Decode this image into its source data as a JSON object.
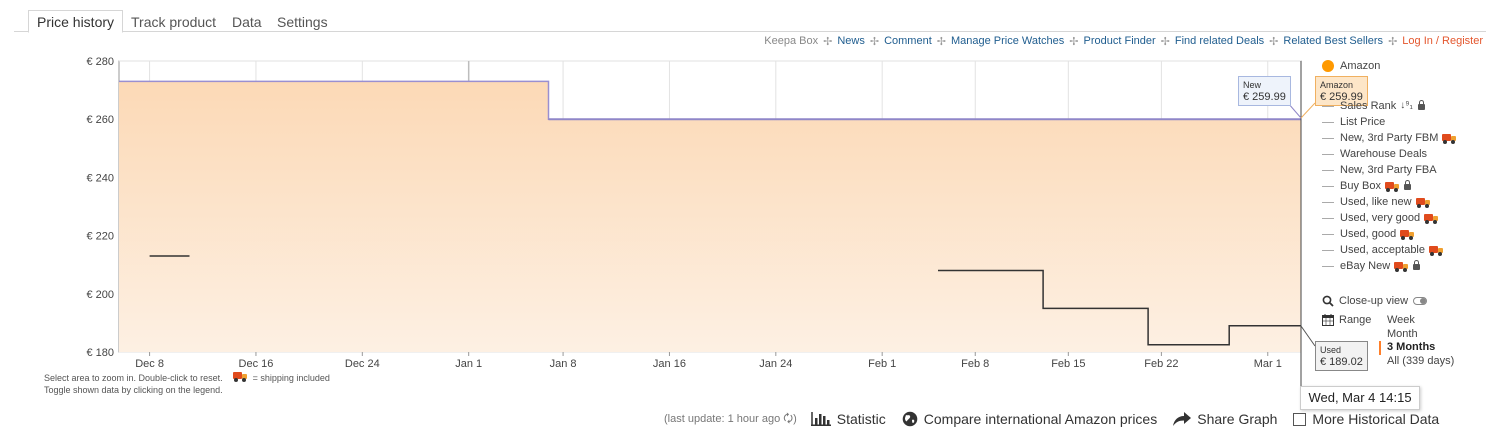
{
  "tabs": [
    {
      "label": "Price history"
    },
    {
      "label": "Track product"
    },
    {
      "label": "Data"
    },
    {
      "label": "Settings"
    }
  ],
  "links": [
    "Keepa Box",
    "News",
    "Comment",
    "Manage Price Watches",
    "Product Finder",
    "Find related Deals",
    "Related Best Sellers",
    "Log In / Register"
  ],
  "legend": {
    "amazon": "Amazon",
    "sales_rank": "Sales Rank",
    "list_price": "List Price",
    "new_fbm": "New, 3rd Party FBM",
    "warehouse": "Warehouse Deals",
    "new_fba": "New, 3rd Party FBA",
    "buy_box": "Buy Box",
    "used_like_new": "Used, like new",
    "used_very_good": "Used, very good",
    "used_good": "Used, good",
    "used_acceptable": "Used, acceptable",
    "ebay_new": "eBay New"
  },
  "controls": {
    "closeup": "Close-up view",
    "range": "Range",
    "range_options": [
      "Week",
      "Month",
      "3 Months",
      "All (339 days)"
    ],
    "range_selected": "3 Months"
  },
  "notes": {
    "line1": "Select area to zoom in. Double-click to reset.",
    "shipping": "= shipping included",
    "line2": "Toggle shown data by clicking on the legend."
  },
  "tooltip_date": "Wed, Mar 4 14:15",
  "bottom": {
    "last_update": "(last update: 1 hour ago",
    "statistic": "Statistic",
    "compare": "Compare international Amazon prices",
    "share": "Share Graph",
    "more": "More Historical Data"
  },
  "colors": {
    "amazon": "#ff9900",
    "amazon_fill": "#fde0c4",
    "new": "#8888cc",
    "used": "#333333",
    "accent": "#ff7f2a"
  },
  "chart_data": {
    "type": "area",
    "currency": "€",
    "ylim": [
      180,
      280
    ],
    "y_ticks": [
      280,
      260,
      240,
      220,
      200,
      180
    ],
    "y_tick_labels": [
      "€ 280",
      "€ 260",
      "€ 240",
      "€ 220",
      "€ 200",
      "€ 180"
    ],
    "x_ticks": [
      "Dec 8",
      "Dec 16",
      "Dec 24",
      "Jan 1",
      "Jan 8",
      "Jan 16",
      "Jan 24",
      "Feb 1",
      "Feb 8",
      "Feb 15",
      "Feb 22",
      "Mar 1"
    ],
    "xlim_days": [
      -2.3,
      86.6
    ],
    "x_tick_days": [
      0,
      8,
      16,
      24,
      31.1,
      39.1,
      47.1,
      55.1,
      62.1,
      69.1,
      76.1,
      84.1
    ],
    "series": [
      {
        "name": "Amazon",
        "kind": "step-area",
        "points": [
          [
            -2.3,
            273
          ],
          [
            30.0,
            273
          ],
          [
            30.0,
            260
          ],
          [
            86.6,
            259.99
          ]
        ]
      },
      {
        "name": "New",
        "kind": "step",
        "points": [
          [
            30.0,
            260
          ],
          [
            86.6,
            259.99
          ]
        ]
      },
      {
        "name": "Used",
        "kind": "step",
        "segments": [
          [
            [
              0,
              213
            ],
            [
              3,
              213
            ]
          ],
          [
            [
              59.3,
              208
            ],
            [
              67.2,
              208
            ],
            [
              67.2,
              195
            ],
            [
              75.1,
              195
            ],
            [
              75.1,
              182.5
            ],
            [
              81.2,
              182.5
            ],
            [
              81.2,
              189.02
            ],
            [
              86.6,
              189.02
            ]
          ]
        ]
      }
    ],
    "labels": {
      "new": {
        "title": "New",
        "value": "€ 259.99"
      },
      "amazon": {
        "title": "Amazon",
        "value": "€ 259.99"
      },
      "used": {
        "title": "Used",
        "value": "€ 189.02"
      }
    }
  }
}
